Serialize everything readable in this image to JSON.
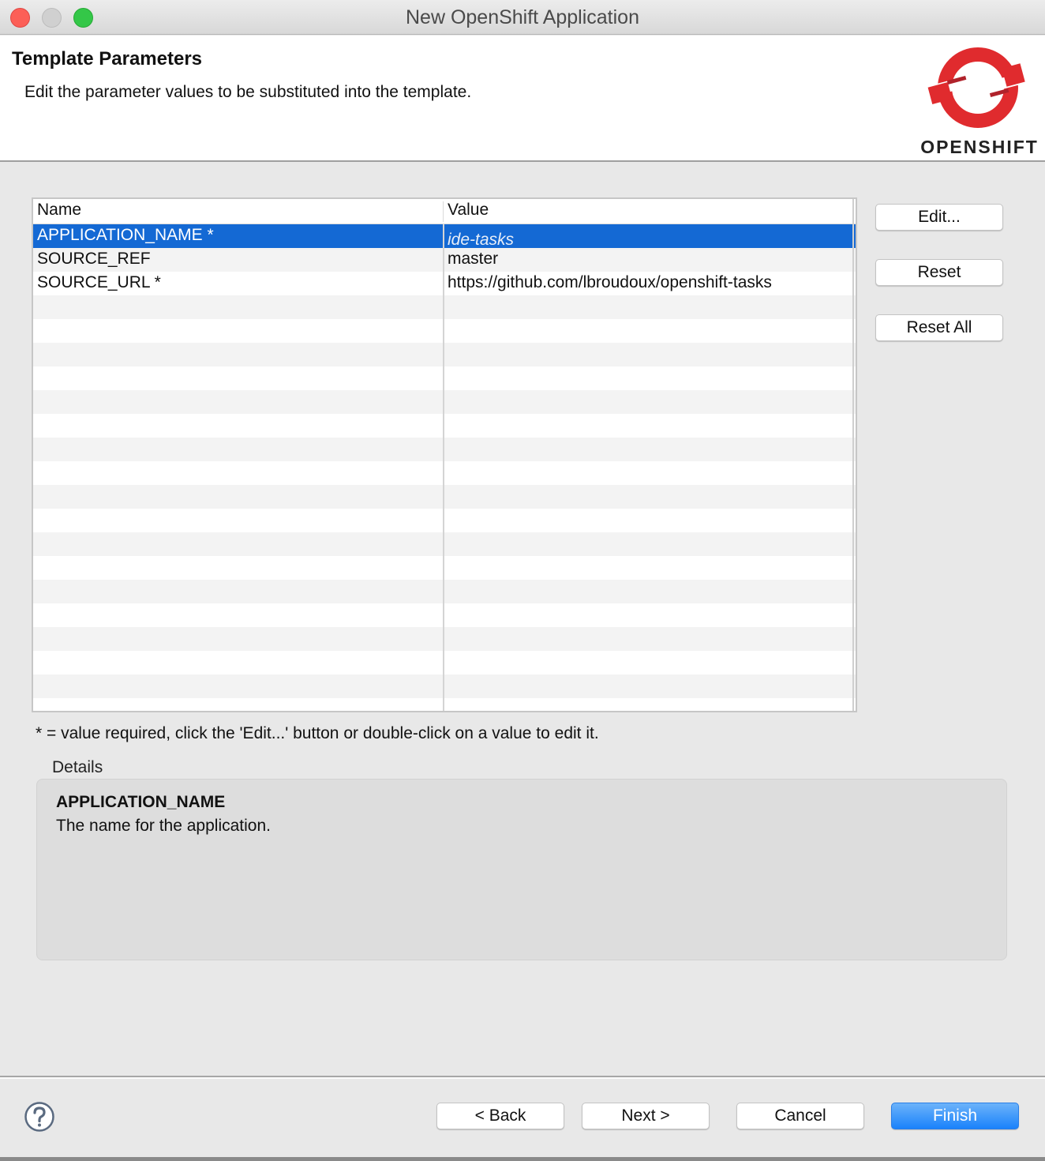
{
  "window": {
    "title": "New OpenShift Application"
  },
  "header": {
    "title": "Template Parameters",
    "description": "Edit the parameter values to be substituted into the template.",
    "logo_text": "OPENSHIFT",
    "logo_icon": "openshift-logo-icon",
    "brand_color": "#e02b2e"
  },
  "table": {
    "columns": [
      "Name",
      "Value"
    ],
    "rows": [
      {
        "name": "APPLICATION_NAME *",
        "value": "ide-tasks",
        "selected": true
      },
      {
        "name": "SOURCE_REF",
        "value": "master",
        "selected": false
      },
      {
        "name": "SOURCE_URL *",
        "value": "https://github.com/lbroudoux/openshift-tasks",
        "selected": false
      }
    ],
    "selection_color": "#1469d4"
  },
  "side_buttons": {
    "edit": "Edit...",
    "reset": "Reset",
    "reset_all": "Reset All"
  },
  "hint": "* = value required, click the 'Edit...' button or double-click on a value to edit it.",
  "details": {
    "label": "Details",
    "param_name": "APPLICATION_NAME",
    "param_description": "The name for the application."
  },
  "footer": {
    "help_icon": "help-icon",
    "back": "< Back",
    "next": "Next >",
    "cancel": "Cancel",
    "finish": "Finish",
    "primary_color": "#1a82fb"
  }
}
